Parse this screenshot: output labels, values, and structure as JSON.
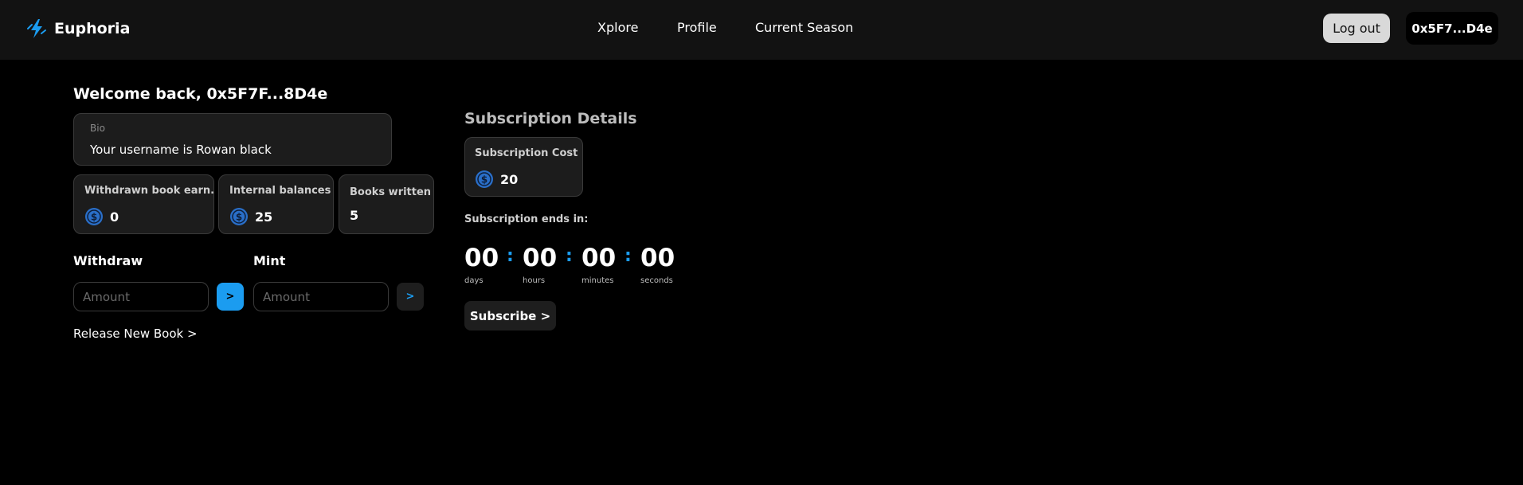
{
  "brand": {
    "name": "Euphoria",
    "accent": "#1b9cf0",
    "icon": "lightning-bolt-icon"
  },
  "nav": {
    "items": [
      "Xplore",
      "Profile",
      "Current Season"
    ]
  },
  "header": {
    "logout_label": "Log out",
    "wallet_label": "0x5F7...D4e"
  },
  "welcome": "Welcome back, 0x5F7F...8D4e",
  "bio": {
    "label": "Bio",
    "text": "Your username is Rowan black"
  },
  "stats": [
    {
      "label": "Withdrawn book earn.",
      "value": "0",
      "icon": "usdc-coin-icon"
    },
    {
      "label": "Internal balances",
      "value": "25",
      "icon": "usdc-coin-icon"
    },
    {
      "label": "Books written",
      "value": "5"
    }
  ],
  "withdraw": {
    "label": "Withdraw",
    "placeholder": "Amount",
    "button": ">"
  },
  "mint": {
    "label": "Mint",
    "placeholder": "Amount",
    "button": ">"
  },
  "release_link": "Release New Book >",
  "subscription": {
    "title": "Subscription Details",
    "cost_label": "Subscription Cost",
    "cost_value": "20",
    "cost_icon": "usdc-coin-icon",
    "ends_label": "Subscription ends in:",
    "countdown": [
      {
        "value": "00",
        "unit": "days"
      },
      {
        "value": "00",
        "unit": "hours"
      },
      {
        "value": "00",
        "unit": "minutes"
      },
      {
        "value": "00",
        "unit": "seconds"
      }
    ],
    "separator": ":",
    "subscribe_label": "Subscribe >"
  }
}
